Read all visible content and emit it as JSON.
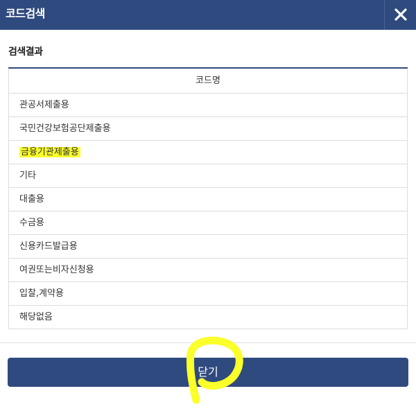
{
  "header": {
    "title": "코드검색",
    "close_icon": "close-icon"
  },
  "section": {
    "title": "검색결과"
  },
  "table": {
    "column_header": "코드명",
    "rows": [
      "관공서제출용",
      "국민건강보험공단제출용",
      "금융기관제출용",
      "기타",
      "대출용",
      "수금용",
      "신용카드발급용",
      "여권또는비자신청용",
      "입찰,계약용",
      "해당없음"
    ],
    "highlighted_row_index": 2
  },
  "footer": {
    "close_button_label": "닫기"
  },
  "colors": {
    "primary": "#2f4a7e",
    "highlight": "#fbff2a"
  }
}
